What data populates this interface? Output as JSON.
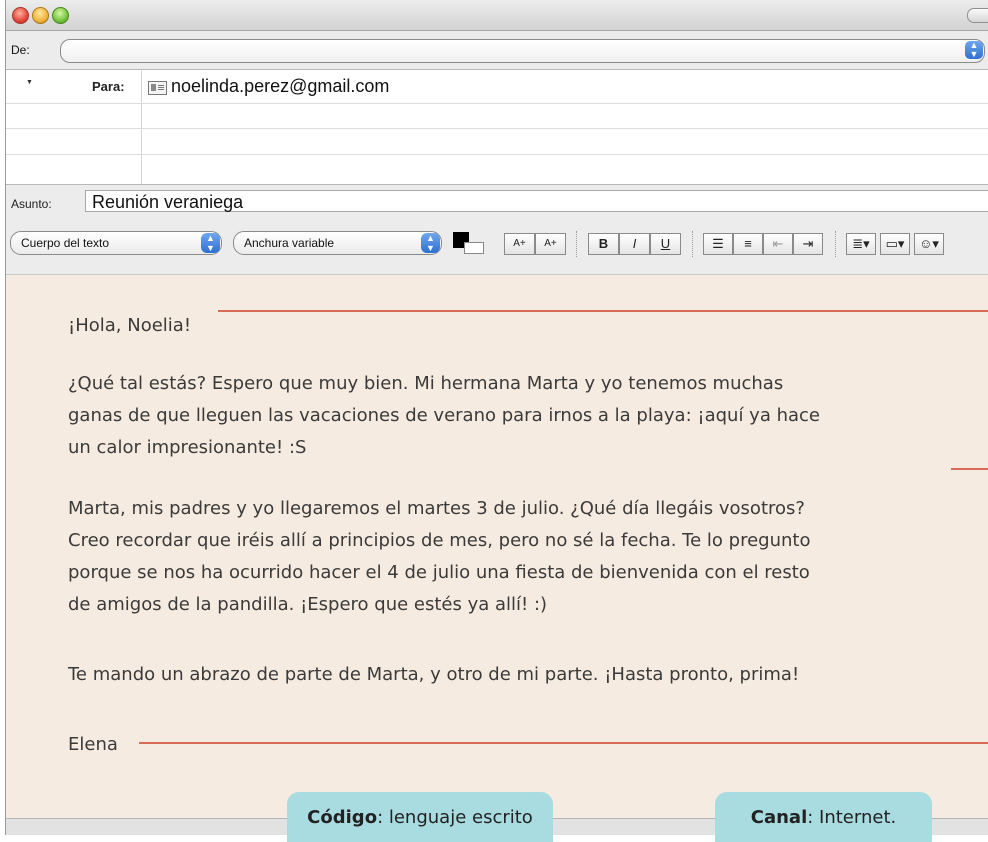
{
  "header": {
    "de_label": "De:",
    "para_label": "Para:",
    "recipient": "noelinda.perez@gmail.com",
    "asunto_label": "Asunto:",
    "subject": "Reunión veraniega"
  },
  "toolbar": {
    "style_select": "Cuerpo del texto",
    "font_select": "Anchura variable",
    "font_bigger": "A+",
    "font_smaller": "A+",
    "bold": "B",
    "italic": "I",
    "underline": "U"
  },
  "message": {
    "greeting": "¡Hola, Noelia!",
    "p1": [
      "¿Qué tal estás? Espero que muy bien. Mi hermana Marta y yo tenemos muchas",
      "ganas de que lleguen las vacaciones de verano para irnos a la playa: ¡aquí ya hace",
      "un calor impresionante! :S"
    ],
    "p2": [
      "Marta, mis padres y yo llegaremos el martes 3 de julio. ¿Qué día llegáis vosotros?",
      "Creo recordar que iréis allí a principios de mes, pero no sé la fecha. Te lo pregunto",
      "porque se nos ha ocurrido hacer el 4 de julio una fiesta de bienvenida con el resto",
      "de amigos de la pandilla. ¡Espero que estés ya allí! :)"
    ],
    "p3": "Te mando un abrazo de parte de Marta, y otro de mi parte. ¡Hasta pronto, prima!",
    "signature": "Elena"
  },
  "callouts": {
    "codigo_label": "Código",
    "codigo_text": ": lenguaje escrito",
    "canal_label": "Canal",
    "canal_text": ": Internet."
  },
  "colors": {
    "body_bg": "#f6ebe0",
    "pointer_line": "#d96a55",
    "callout_bg": "#a9dce0"
  }
}
